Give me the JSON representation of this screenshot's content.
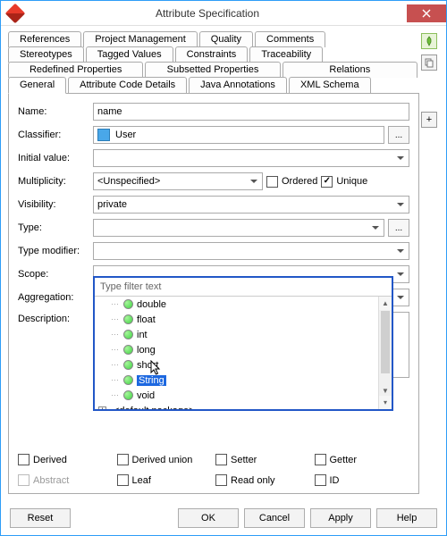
{
  "window": {
    "title": "Attribute Specification"
  },
  "tabs_row1": [
    "References",
    "Project Management",
    "Quality",
    "Comments"
  ],
  "tabs_row2": [
    "Stereotypes",
    "Tagged Values",
    "Constraints",
    "Traceability"
  ],
  "tabs_row3": [
    "Redefined Properties",
    "Subsetted Properties",
    "Relations"
  ],
  "tabs_row4": [
    "General",
    "Attribute Code Details",
    "Java Annotations",
    "XML Schema"
  ],
  "active_tab": "General",
  "form": {
    "name_label": "Name:",
    "name_value": "name",
    "classifier_label": "Classifier:",
    "classifier_value": "User",
    "initial_label": "Initial value:",
    "initial_value": "",
    "multiplicity_label": "Multiplicity:",
    "multiplicity_value": "<Unspecified>",
    "ordered_label": "Ordered",
    "ordered_checked": false,
    "unique_label": "Unique",
    "unique_checked": true,
    "visibility_label": "Visibility:",
    "visibility_value": "private",
    "type_label": "Type:",
    "type_value": "",
    "type_modifier_label": "Type modifier:",
    "type_modifier_value": "",
    "scope_label": "Scope:",
    "scope_value": "",
    "aggregation_label": "Aggregation:",
    "aggregation_value": "",
    "description_label": "Description:"
  },
  "popup": {
    "filter_placeholder": "Type filter text",
    "items": [
      "double",
      "float",
      "int",
      "long",
      "short",
      "String",
      "void"
    ],
    "selected": "String",
    "package_label": "<default package>"
  },
  "checks": {
    "derived": "Derived",
    "derived_union": "Derived union",
    "setter": "Setter",
    "getter": "Getter",
    "abstract": "Abstract",
    "leaf": "Leaf",
    "read_only": "Read only",
    "id": "ID"
  },
  "buttons": {
    "reset": "Reset",
    "ok": "OK",
    "cancel": "Cancel",
    "apply": "Apply",
    "help": "Help"
  },
  "side": {
    "pin": "pin",
    "copy": "copy",
    "add": "+"
  }
}
